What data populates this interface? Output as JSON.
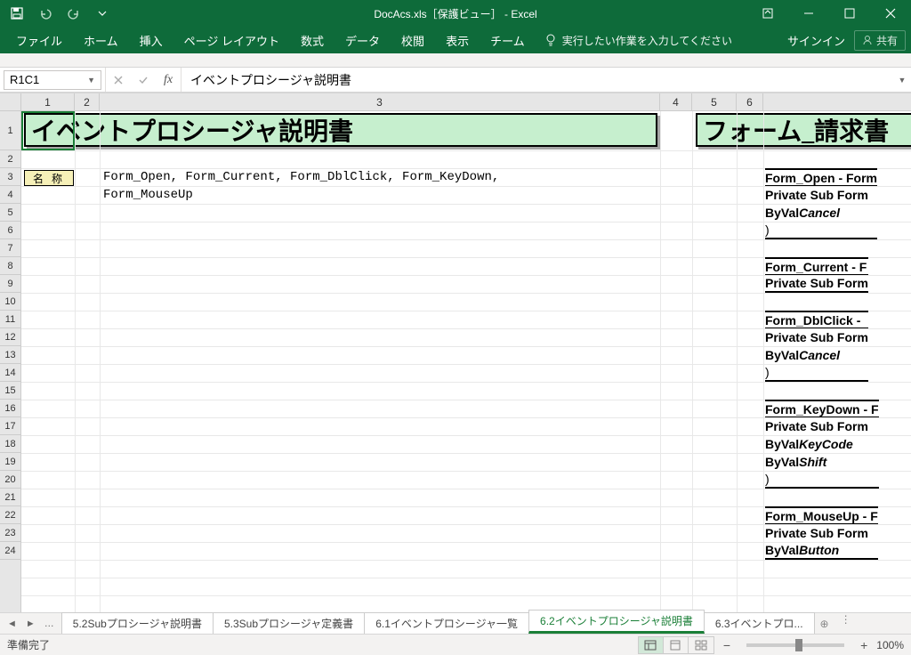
{
  "titlebar": {
    "title": "DocAcs.xls［保護ビュー］ - Excel"
  },
  "ribbon": {
    "tabs": [
      "ファイル",
      "ホーム",
      "挿入",
      "ページ レイアウト",
      "数式",
      "データ",
      "校閲",
      "表示",
      "チーム"
    ],
    "tellme": "実行したい作業を入力してください",
    "signin": "サインイン",
    "share": "共有"
  },
  "formulabar": {
    "namebox": "R1C1",
    "formula": "イベントプロシージャ説明書"
  },
  "columns": [
    "1",
    "2",
    "3",
    "4",
    "5",
    "6"
  ],
  "sheet": {
    "title1": "イベントプロシージャ説明書",
    "title2": "フォーム_請求書",
    "label": "名 称",
    "r3": "Form_Open, Form_Current, Form_DblClick, Form_KeyDown,",
    "r4": "Form_MouseUp",
    "right_blocks": [
      {
        "header": "Form_Open - Form",
        "lines": [
          "Private Sub Form",
          "  ByVal Cancel  ",
          ")"
        ]
      },
      {
        "header": "Form_Current - F",
        "lines": [
          "Private Sub Form"
        ]
      },
      {
        "header": "Form_DblClick - ",
        "lines": [
          "Private Sub Form",
          "  ByVal Cancel  ",
          ")"
        ]
      },
      {
        "header": "Form_KeyDown - F",
        "lines": [
          "Private Sub Form",
          "  ByVal KeyCode ",
          "  ByVal Shift   ",
          ")"
        ]
      },
      {
        "header": "Form_MouseUp - F",
        "lines": [
          "Private Sub Form",
          "  ByVal Button  "
        ]
      }
    ]
  },
  "sheettabs": {
    "tabs": [
      "5.2Subプロシージャ説明書",
      "5.3Subプロシージャ定義書",
      "6.1イベントプロシージャ一覧",
      "6.2イベントプロシージャ説明書",
      "6.3イベントプロ..."
    ],
    "active": 3
  },
  "statusbar": {
    "ready": "準備完了",
    "zoom": "100%"
  }
}
